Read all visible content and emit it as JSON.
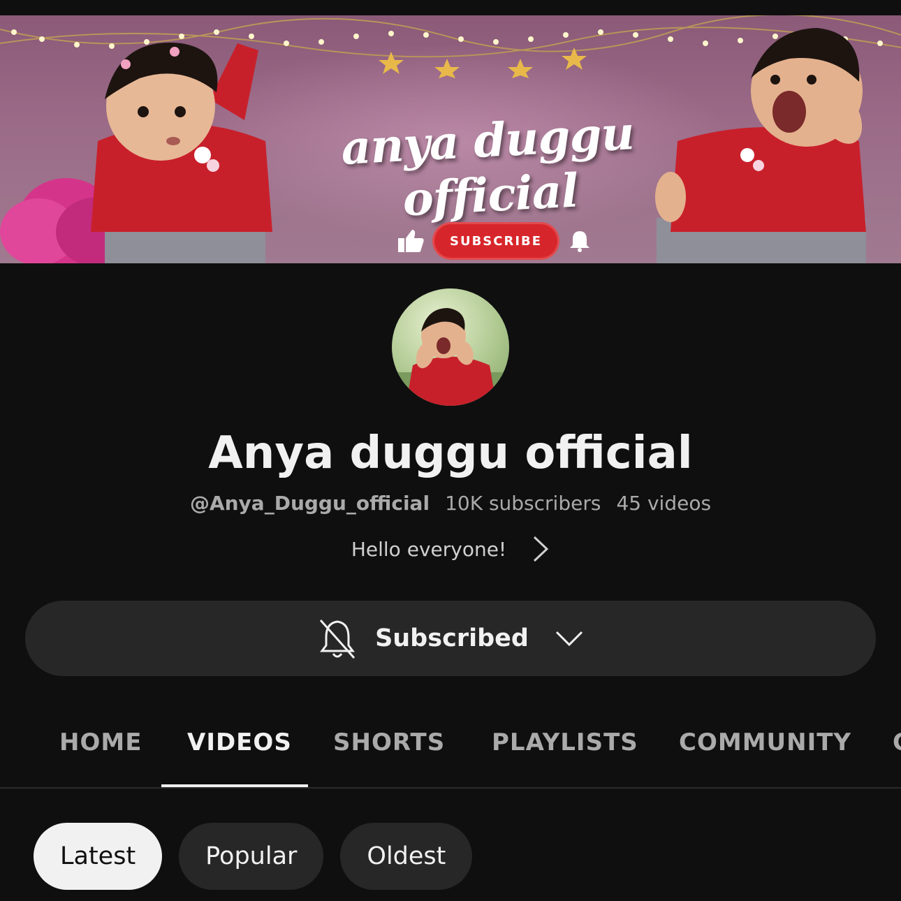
{
  "banner": {
    "title": "anya duggu official",
    "subscribe_label": "SUBSCRIBE"
  },
  "channel": {
    "name": "Anya duggu official",
    "handle": "@Anya_Duggu_official",
    "subscribers": "10K subscribers",
    "videos": "45 videos",
    "description": "Hello everyone!"
  },
  "subscribe_button": {
    "label": "Subscribed"
  },
  "tabs": [
    {
      "label": "HOME"
    },
    {
      "label": "VIDEOS"
    },
    {
      "label": "SHORTS"
    },
    {
      "label": "PLAYLISTS"
    },
    {
      "label": "COMMUNITY"
    },
    {
      "label": "C"
    }
  ],
  "active_tab": "VIDEOS",
  "sort_chips": [
    {
      "label": "Latest"
    },
    {
      "label": "Popular"
    },
    {
      "label": "Oldest"
    }
  ],
  "selected_chip": "Latest",
  "colors": {
    "background": "#0f0f0f",
    "surface": "#272727",
    "text": "#f1f1f1",
    "secondary_text": "#aaaaaa",
    "banner_red": "#d7262b"
  }
}
